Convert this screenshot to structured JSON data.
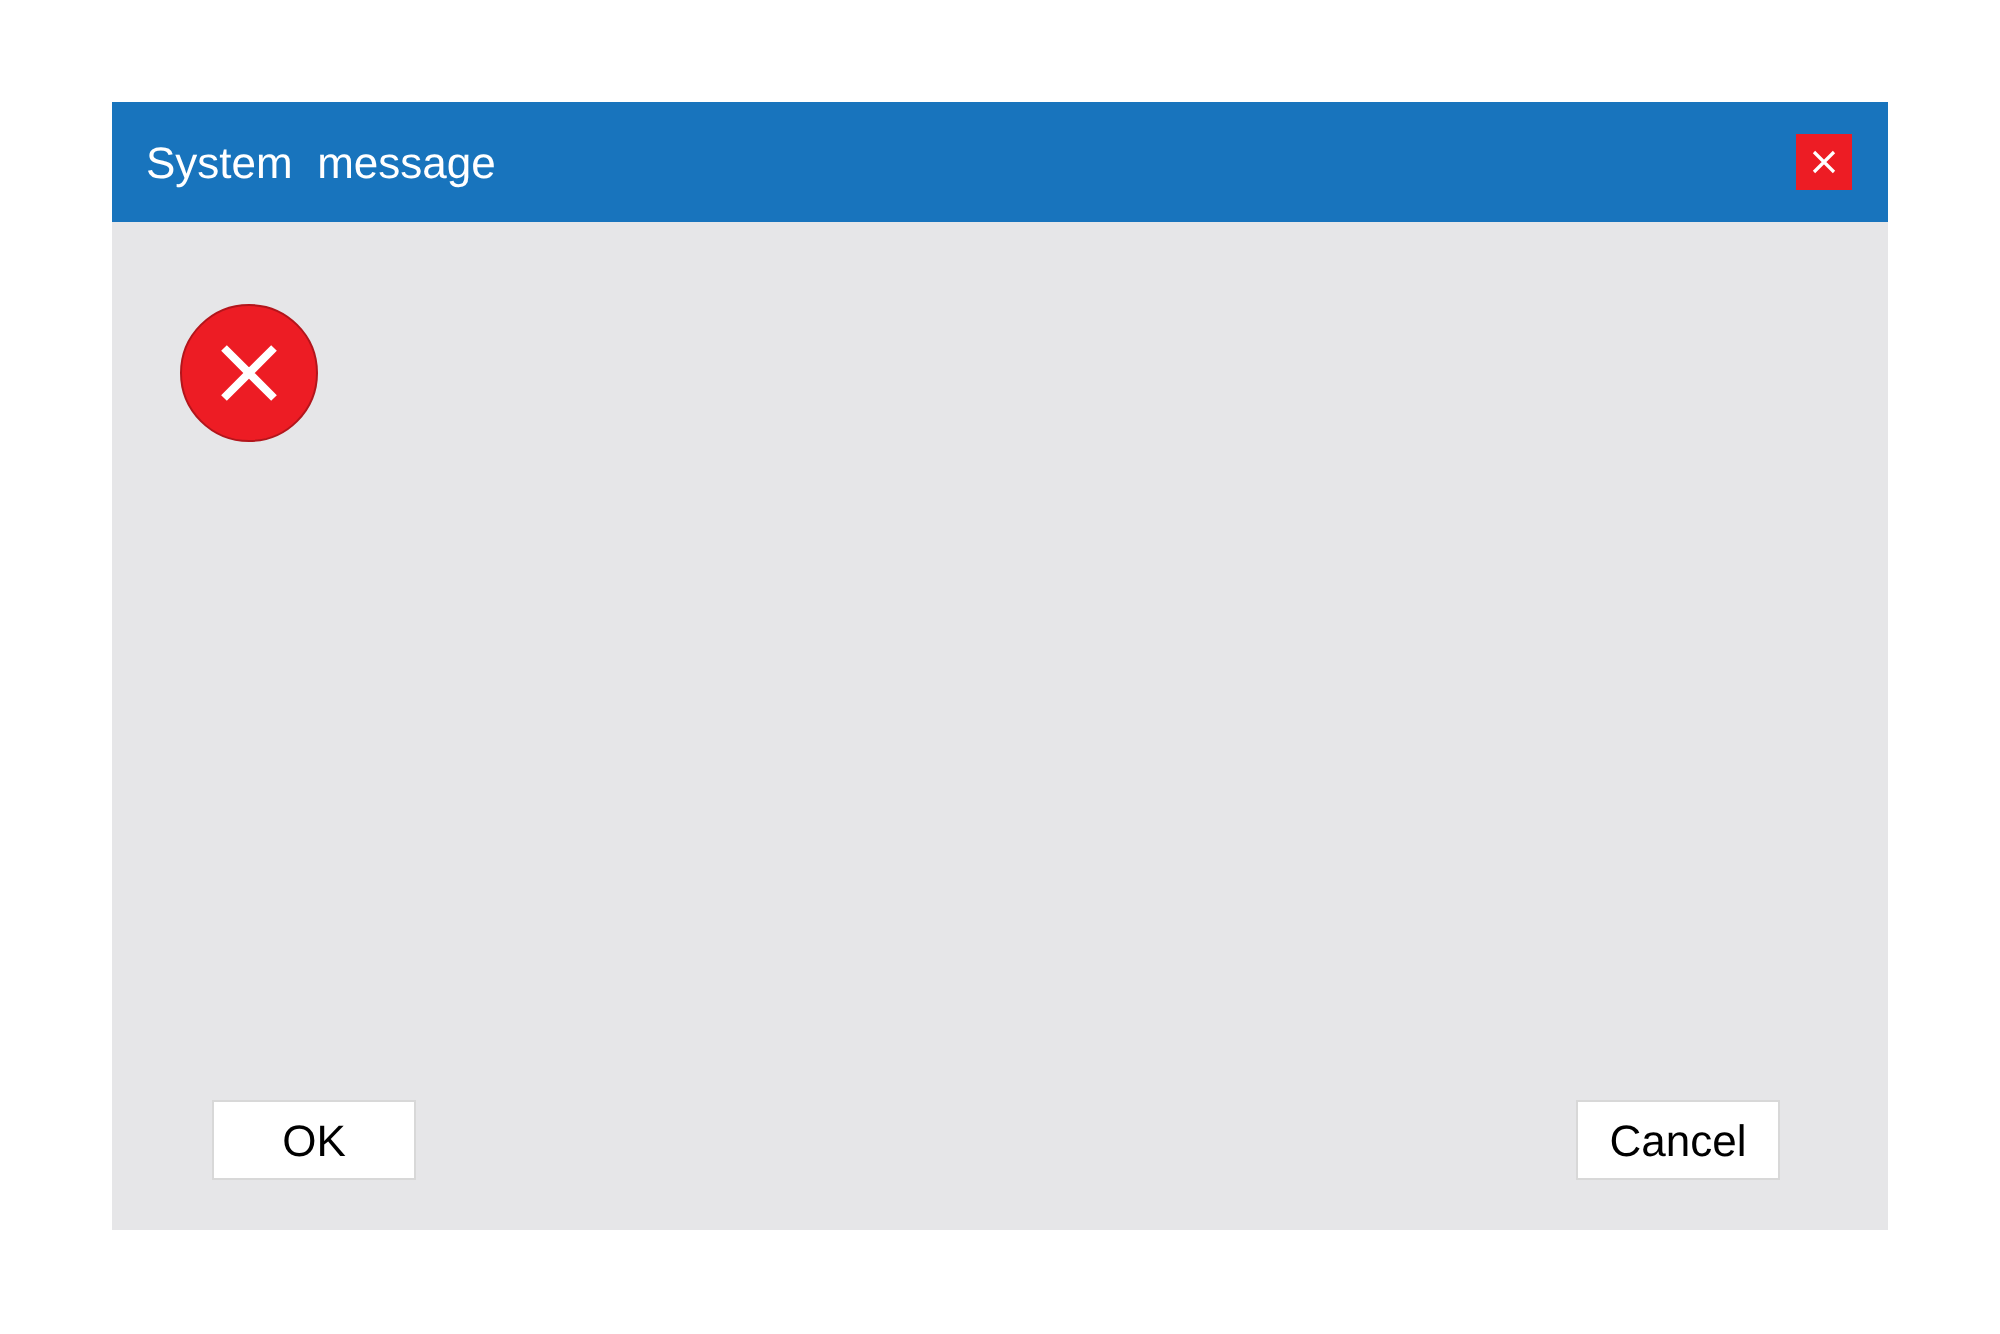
{
  "window": {
    "title": "System  message"
  },
  "message": {
    "kind": "error"
  },
  "buttons": [
    "OK",
    "Cancel"
  ]
}
